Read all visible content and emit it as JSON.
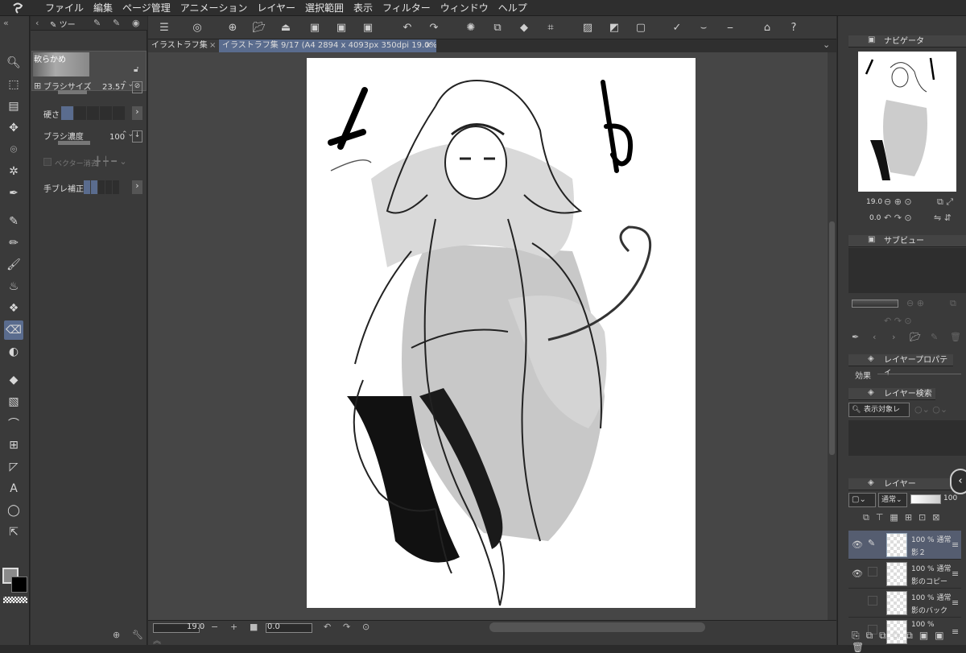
{
  "menu": [
    "ファイル",
    "編集",
    "ページ管理",
    "アニメーション",
    "レイヤー",
    "選択範囲",
    "表示",
    "フィルター",
    "ウィンドウ",
    "ヘルプ"
  ],
  "left_tools": [
    "zoom-icon",
    "lasso-icon",
    "page-icon",
    "move-icon",
    "select-icon",
    "wand-icon",
    "eyedropper-icon",
    "pen-icon",
    "pencil-icon",
    "brush-icon",
    "airbrush-icon",
    "decoration-icon",
    "eraser-icon",
    "blend-icon",
    "fill-icon",
    "gradient-icon",
    "curve-icon",
    "frame-icon",
    "ruler-icon",
    "text-icon",
    "balloon-icon",
    "correct-line-icon"
  ],
  "subtool": {
    "tab_label": "ツー",
    "preset_name": "軟らかめ",
    "brush_size_label": "ブラシサイズ",
    "brush_size_value": "23.57",
    "hardness_label": "硬さ",
    "density_label": "ブラシ濃度",
    "density_value": "100",
    "vector_label": "ベクター消去",
    "stabilize_label": "手ブレ補正"
  },
  "tabs": [
    {
      "label": "イラストラフ集",
      "active": false
    },
    {
      "label": "イラストラフ集 9/17 (A4 2894 x 4093px 350dpi 19.0%)",
      "active": true
    }
  ],
  "status": {
    "zoom": "19.0",
    "angle": "0.0"
  },
  "navigator": {
    "title": "ナビゲータ",
    "zoom": "19.0",
    "angle": "0.0"
  },
  "subview": {
    "title": "サブビュー"
  },
  "layer_property": {
    "title": "レイヤープロパティ",
    "effect_label": "効果"
  },
  "layer_search": {
    "title": "レイヤー検索",
    "filter": "表示対象レ"
  },
  "layers_panel": {
    "title": "レイヤー",
    "blend": "通常",
    "opacity": "100"
  },
  "layers": [
    {
      "opacity": "100 % 通常",
      "name": "影２",
      "selected": true,
      "visible": true
    },
    {
      "opacity": "100 % 通常",
      "name": "影のコピー",
      "selected": false,
      "visible": true
    },
    {
      "opacity": "100 % 通常",
      "name": "影のバック",
      "selected": false,
      "visible": false
    },
    {
      "opacity": "100 %",
      "name": "",
      "selected": false,
      "visible": false
    }
  ],
  "colors": {
    "accent": "#5a6c8e",
    "main_color": "#8a8a8a",
    "sub_color": "#000000"
  }
}
